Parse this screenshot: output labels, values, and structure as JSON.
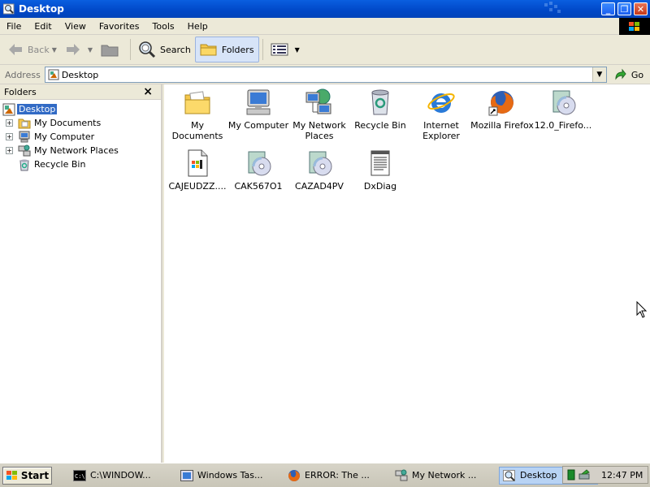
{
  "window": {
    "title": "Desktop",
    "controls": {
      "minimize": "_",
      "maximize": "❐",
      "close": "✕"
    }
  },
  "menu": [
    "File",
    "Edit",
    "View",
    "Favorites",
    "Tools",
    "Help"
  ],
  "toolbar": {
    "back_label": "Back",
    "search_label": "Search",
    "folders_label": "Folders"
  },
  "address": {
    "label": "Address",
    "value": "Desktop",
    "go_label": "Go"
  },
  "folders_pane": {
    "header": "Folders",
    "close": "×",
    "tree": [
      {
        "label": "Desktop",
        "icon": "desktop-icon",
        "selected": true
      },
      {
        "label": "My Documents",
        "icon": "folder-documents-icon",
        "expand": "+"
      },
      {
        "label": "My Computer",
        "icon": "computer-icon",
        "expand": "+"
      },
      {
        "label": "My Network Places",
        "icon": "network-icon",
        "expand": "+"
      },
      {
        "label": "Recycle Bin",
        "icon": "recycle-bin-icon"
      }
    ]
  },
  "desktop_items": [
    {
      "label": "My Documents",
      "icon": "folder-documents-icon"
    },
    {
      "label": "My Computer",
      "icon": "computer-icon"
    },
    {
      "label": "My Network Places",
      "icon": "network-icon"
    },
    {
      "label": "Recycle Bin",
      "icon": "recycle-bin-icon"
    },
    {
      "label": "Internet Explorer",
      "icon": "internet-explorer-icon"
    },
    {
      "label": "Mozilla Firefox",
      "icon": "firefox-icon"
    },
    {
      "label": "12.0_Firefo...",
      "icon": "installer-cd-icon"
    },
    {
      "label": "CAJEUDZZ....",
      "icon": "media-file-icon"
    },
    {
      "label": "CAK567O1",
      "icon": "installer-cd-icon"
    },
    {
      "label": "CAZAD4PV",
      "icon": "installer-cd-icon"
    },
    {
      "label": "DxDiag",
      "icon": "text-file-icon"
    }
  ],
  "taskbar": {
    "start_label": "Start",
    "tasks": [
      {
        "label": "C:\\WINDOW...",
        "icon": "cmd-icon"
      },
      {
        "label": "Windows Tas...",
        "icon": "task-manager-icon"
      },
      {
        "label": "ERROR: The ...",
        "icon": "firefox-icon"
      },
      {
        "label": "My Network ...",
        "icon": "network-icon"
      },
      {
        "label": "Desktop",
        "icon": "explorer-search-icon",
        "active": true
      }
    ],
    "clock": "12:47 PM"
  }
}
